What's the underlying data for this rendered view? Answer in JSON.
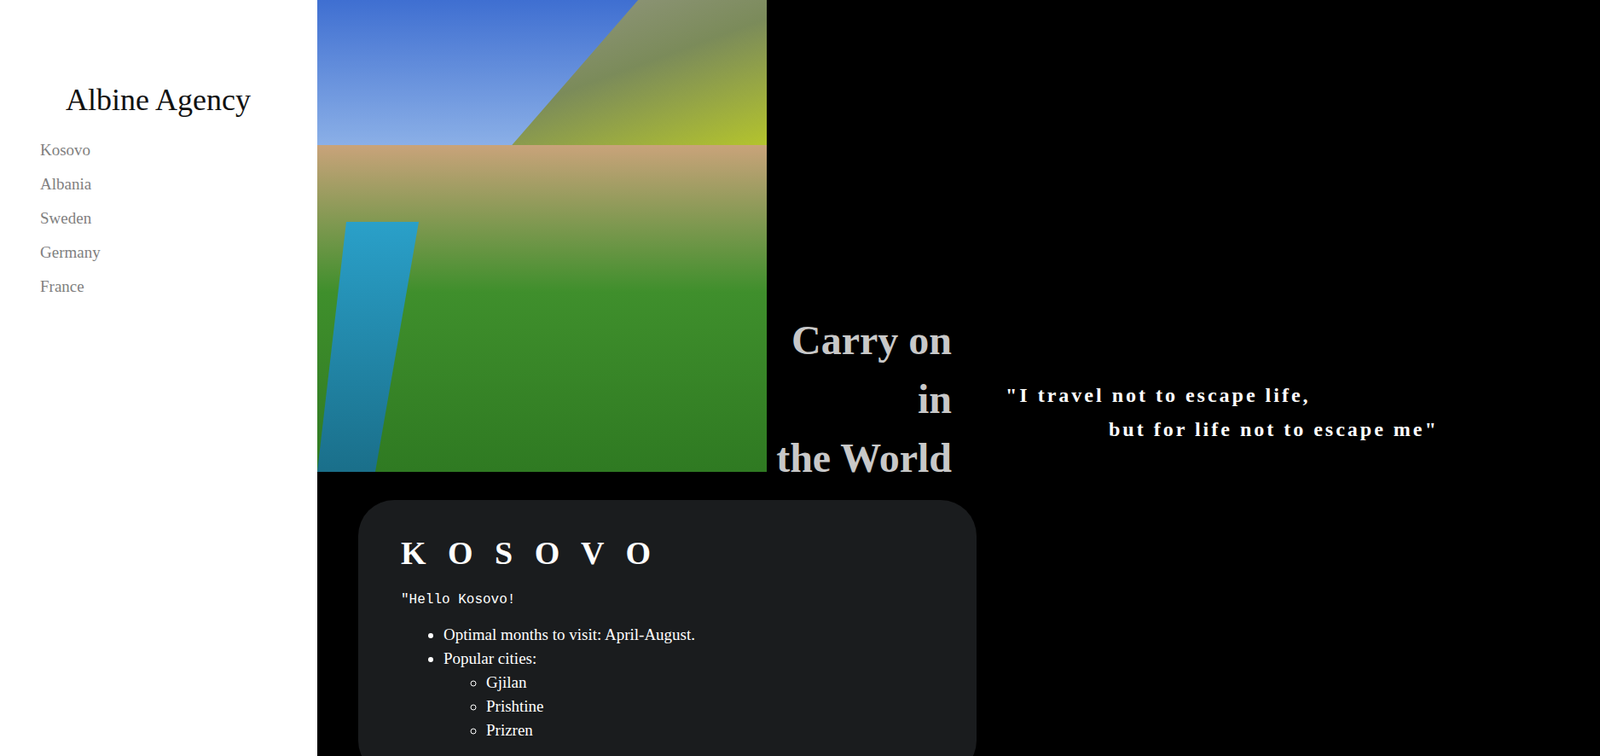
{
  "sidebar": {
    "title": "Albine Agency",
    "items": [
      {
        "label": "Kosovo"
      },
      {
        "label": "Albania"
      },
      {
        "label": "Sweden"
      },
      {
        "label": "Germany"
      },
      {
        "label": "France"
      }
    ]
  },
  "hero": {
    "tagline": [
      "Carry on",
      "in",
      "the World"
    ],
    "quote": [
      "\"I travel not to escape life,",
      "but for life not to escape me\""
    ]
  },
  "card": {
    "title": "K O S O V O",
    "intro": "\"Hello Kosovo!",
    "facts": [
      {
        "text": "Optimal months to visit: April-August.",
        "children": []
      },
      {
        "text": "Popular cities:",
        "children": [
          "Gjilan",
          "Prishtine",
          "Prizren"
        ]
      }
    ]
  }
}
